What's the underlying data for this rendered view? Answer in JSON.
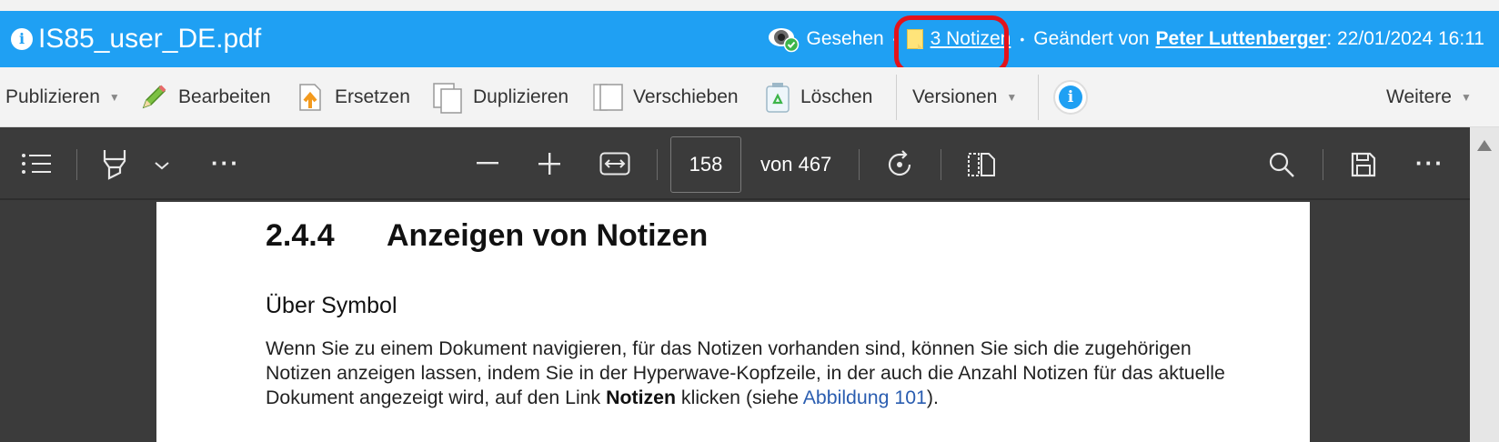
{
  "header": {
    "file_name": "IS85_user_DE.pdf",
    "seen_label": "Gesehen",
    "notes_link": "3 Notizen",
    "changed_by_label": "Geändert von",
    "changed_by_user": "Peter Luttenberger",
    "changed_date": ": 22/01/2024 16:11",
    "bullet": "•",
    "highlight_color": "#e3131b"
  },
  "actions": {
    "publish": "Publizieren",
    "edit": "Bearbeiten",
    "replace": "Ersetzen",
    "duplicate": "Duplizieren",
    "move": "Verschieben",
    "delete": "Löschen",
    "versions": "Versionen",
    "more": "Weitere",
    "caret": "▼"
  },
  "viewer": {
    "page_number": "158",
    "page_total": "von 467",
    "more_glyph": "···"
  },
  "page": {
    "section_number": "2.4.4",
    "section_title": "Anzeigen von Notizen",
    "subheading": "Über Symbol",
    "para_1": "Wenn Sie zu einem Dokument navigieren, für das Notizen vorhanden sind, können Sie sich die zugehörigen Notizen anzeigen lassen, indem Sie in der Hyperwave-Kopfzeile, in der auch die Anzahl Notizen für das aktuelle Dokument angezeigt wird, auf den Link ",
    "para_bold": "Notizen",
    "para_2": " klicken (siehe ",
    "para_link": "Abbildung 101",
    "para_3": ")."
  },
  "colors": {
    "header_bg": "#1fa0f3",
    "viewer_bg": "#3b3b3b",
    "link": "#2a5db0"
  }
}
